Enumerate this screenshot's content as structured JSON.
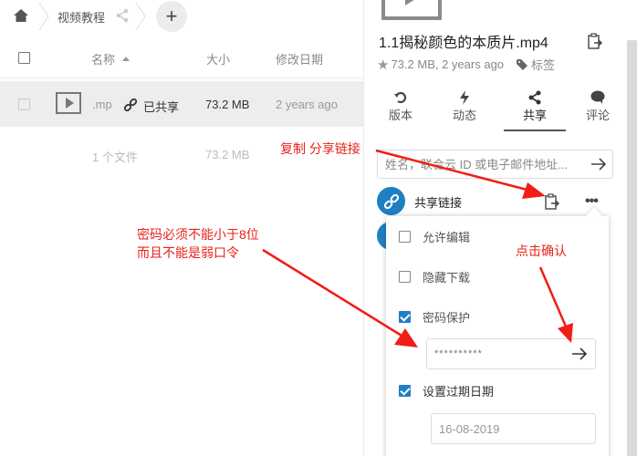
{
  "breadcrumb": {
    "home_icon": "home-icon",
    "folder": "视频教程",
    "share_icon": "share-icon",
    "add_label": "+"
  },
  "table": {
    "headers": {
      "name": "名称",
      "size": "大小",
      "modified": "修改日期"
    },
    "rows": [
      {
        "name": ".mp",
        "share_status": "已共享",
        "size": "73.2 MB",
        "modified": "2 years ago"
      }
    ],
    "summary": {
      "count": "1 个文件",
      "size": "73.2 MB"
    }
  },
  "sidebar": {
    "file_title": "1.1揭秘颜色的本质片.mp4",
    "meta": "73.2 MB, 2 years ago",
    "tags_label": "标签",
    "tabs": [
      {
        "label": "版本",
        "icon": "history-icon"
      },
      {
        "label": "动态",
        "icon": "activity-icon"
      },
      {
        "label": "共享",
        "icon": "share-icon",
        "active": true
      },
      {
        "label": "评论",
        "icon": "comment-icon"
      }
    ],
    "share_input_placeholder": "姓名，联合云 ID 或电子邮件地址...",
    "share_link_label": "共享链接",
    "more_label": "•••",
    "popover": {
      "allow_edit": {
        "label": "允许编辑",
        "checked": false
      },
      "hide_download": {
        "label": "隐藏下载",
        "checked": false
      },
      "password_protect": {
        "label": "密码保护",
        "checked": true
      },
      "password_value": "**********",
      "set_expiration": {
        "label": "设置过期日期",
        "checked": true
      },
      "expiration_value": "16-08-2019"
    }
  },
  "annotations": {
    "copy_link": "复制 分享链接",
    "password_rule_line1": "密码必须不能小于8位",
    "password_rule_line2": "而且不能是弱口令",
    "click_confirm": "点击确认",
    "color": "#e8221a"
  },
  "colors": {
    "accent": "#1f7fc4",
    "row_selected": "#ededed"
  }
}
